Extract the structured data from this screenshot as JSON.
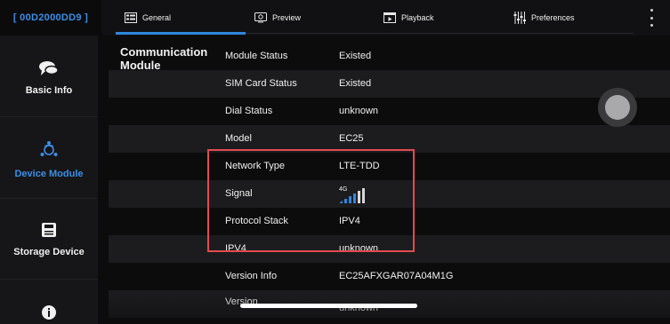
{
  "header": {
    "device_id": "[ 00D2000DD9 ]",
    "tabs": [
      {
        "label": "General",
        "icon": "general-icon",
        "active": true
      },
      {
        "label": "Preview",
        "icon": "preview-icon"
      },
      {
        "label": "Playback",
        "icon": "playback-icon"
      },
      {
        "label": "Preferences",
        "icon": "preferences-icon"
      }
    ],
    "accent_color": "#2f86dd"
  },
  "sidebar": {
    "items": [
      {
        "label": "Basic Info",
        "icon": "chat-bubbles-icon"
      },
      {
        "label": "Device Module",
        "icon": "device-module-icon",
        "active": true
      },
      {
        "label": "Storage Device",
        "icon": "storage-icon"
      },
      {
        "label": "",
        "icon": "info-icon"
      }
    ]
  },
  "section": {
    "title": "Communication Module",
    "rows": [
      {
        "label": "Module Status",
        "value": "Existed"
      },
      {
        "label": "SIM Card Status",
        "value": "Existed"
      },
      {
        "label": "Dial Status",
        "value": "unknown"
      },
      {
        "label": "Model",
        "value": "EC25"
      },
      {
        "label": "Network Type",
        "value": "LTE-TDD"
      },
      {
        "label": "Signal",
        "value": "4G",
        "signal_bars": 4
      },
      {
        "label": "Protocol Stack",
        "value": "IPV4"
      },
      {
        "label": "IPV4",
        "value": "unknown"
      },
      {
        "label": "Version Info",
        "value": "EC25AFXGAR07A04M1G"
      },
      {
        "label": "Version",
        "value": "unknown"
      }
    ]
  },
  "highlight_color": "#e24a50"
}
